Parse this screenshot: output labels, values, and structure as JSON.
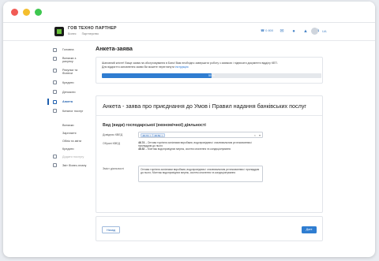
{
  "header": {
    "company_name": "ГОВ ТЕХНО ПАРТНЕР",
    "company_sub_1": "Бізнес",
    "company_sub_2": "Партнерство",
    "phone": "0 800",
    "lang": "UA"
  },
  "sidebar": {
    "items": [
      {
        "label": "Головна"
      },
      {
        "label": "Виписки з рахунку"
      },
      {
        "label": "Рахунки та бізнеси"
      },
      {
        "label": "Кредити"
      },
      {
        "label": "Депозити"
      },
      {
        "label": "Анкета"
      },
      {
        "label": "Каталог послуг"
      }
    ],
    "sub_items": [
      {
        "label": "Виписки"
      },
      {
        "label": "Зарплатні"
      },
      {
        "label": "Облік та звіти"
      },
      {
        "label": "Кредити"
      },
      {
        "label": "Додати послугу"
      },
      {
        "label": "Звіт бізнес-плану"
      }
    ]
  },
  "main": {
    "page_title": "Анкета-заява",
    "notice": {
      "text": "Шановний клієнт! Вище заява на обслуговування в Банк! Вам необхідно завершити роботу з заявкою і підписати документи відділу КЕП.",
      "text2": "Для відкриття заповнення заяви Ви можете переглянути",
      "link": "інструкцію",
      "progress_label": "50 %",
      "progress_value": 0.5
    },
    "form": {
      "title": "Анкета - заява про приєднання до Умов і Правил надання банківських послуг",
      "section_title": "Вид (види) господарської (економічної) діяльності",
      "label_kved": "Довідник КВЕД",
      "chip1": "46.74",
      "chip2": "46.52",
      "label_selected": "Обрані КВЕД",
      "desc1_code": "46.74",
      "desc1_text": "– Оптова торгівля залізними виробами, водопровідним і опалювальним устаткованням і приладдям до нього",
      "desc2_code": "46.52",
      "desc2_text": "– Монтаж водопровідних мереж, систем опалення та кондиціонування",
      "label_activity": "Зміст діяльності",
      "activity_text": "Оптова торгівля залізними виробами, водопровідним і опалювальним устаткованням і приладдям до нього; Монтаж водопровідних мереж, систем опалення та кондиціонування"
    },
    "footer": {
      "back_label": "Назад",
      "next_label": "Далі"
    }
  },
  "colors": {
    "accent": "#2f7dd1",
    "logo_green": "#69c13b"
  }
}
